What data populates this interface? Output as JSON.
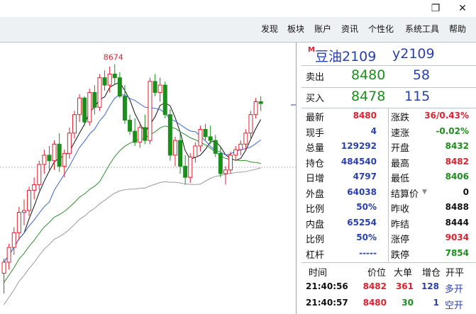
{
  "window": {
    "restore_glyph": "❐",
    "close_glyph": "✕"
  },
  "menu": [
    "发现",
    "板块",
    "账户",
    "资讯",
    "个性化",
    "系统工具",
    "帮助"
  ],
  "quote": {
    "badge": "M",
    "title": "豆油2109",
    "code": "y2109",
    "ask": {
      "label": "卖出",
      "price": "8480",
      "volume": "58"
    },
    "bid": {
      "label": "买入",
      "price": "8478",
      "volume": "115"
    }
  },
  "stats_left": [
    {
      "label": "最新",
      "value": "8480",
      "color": "red"
    },
    {
      "label": "现手",
      "value": "4",
      "color": "blue"
    },
    {
      "label": "总量",
      "value": "129292",
      "color": "blue"
    },
    {
      "label": "持仓",
      "value": "484540",
      "color": "blue"
    },
    {
      "label": "日增",
      "value": "4797",
      "color": "blue"
    },
    {
      "label": "外盘",
      "value": "64038",
      "color": "blue"
    },
    {
      "label": "比例",
      "value": "50%",
      "color": "blue"
    },
    {
      "label": "内盘",
      "value": "65254",
      "color": "blue"
    },
    {
      "label": "比例",
      "value": "50%",
      "color": "blue"
    },
    {
      "label": "杠杆",
      "value": "-----",
      "color": "blue"
    }
  ],
  "stats_right": [
    {
      "label": "涨跌",
      "value": "36/0.43%",
      "color": "red"
    },
    {
      "label": "速涨",
      "value": "-0.02%",
      "color": "green"
    },
    {
      "label": "开盘",
      "value": "8432",
      "color": "green"
    },
    {
      "label": "最高",
      "value": "8482",
      "color": "red"
    },
    {
      "label": "最低",
      "value": "8406",
      "color": "green"
    },
    {
      "label": "结算价",
      "value": "0",
      "color": "black"
    },
    {
      "label": "昨收",
      "value": "8488",
      "color": "black"
    },
    {
      "label": "昨结",
      "value": "8444",
      "color": "black"
    },
    {
      "label": "涨停",
      "value": "9034",
      "color": "red"
    },
    {
      "label": "跌停",
      "value": "7854",
      "color": "green"
    }
  ],
  "ticks": {
    "headers": [
      "时间",
      "价位",
      "大单",
      "增仓",
      "开平"
    ],
    "rows": [
      {
        "time": "21:40:56",
        "price": "8482",
        "size": "361",
        "oi": "128",
        "type": "多开"
      },
      {
        "time": "21:40:57",
        "price": "8480",
        "size": "30",
        "oi": "1",
        "type": "空开"
      }
    ]
  },
  "chart_data": {
    "type": "candlestick",
    "annotations": [
      "8674"
    ],
    "candles": [
      {
        "o": 7540,
        "h": 7620,
        "l": 7430,
        "c": 7600
      },
      {
        "o": 7600,
        "h": 7700,
        "l": 7560,
        "c": 7680
      },
      {
        "o": 7680,
        "h": 7790,
        "l": 7640,
        "c": 7760
      },
      {
        "o": 7760,
        "h": 7900,
        "l": 7720,
        "c": 7870
      },
      {
        "o": 7870,
        "h": 7940,
        "l": 7800,
        "c": 7880
      },
      {
        "o": 7880,
        "h": 8010,
        "l": 7850,
        "c": 7990
      },
      {
        "o": 7990,
        "h": 8060,
        "l": 7940,
        "c": 8020
      },
      {
        "o": 8020,
        "h": 8150,
        "l": 7990,
        "c": 8130
      },
      {
        "o": 8130,
        "h": 8210,
        "l": 8080,
        "c": 8180
      },
      {
        "o": 8180,
        "h": 8230,
        "l": 8100,
        "c": 8150
      },
      {
        "o": 8150,
        "h": 8260,
        "l": 8100,
        "c": 8240
      },
      {
        "o": 8240,
        "h": 8300,
        "l": 8090,
        "c": 8120
      },
      {
        "o": 8120,
        "h": 8210,
        "l": 8060,
        "c": 8190
      },
      {
        "o": 8190,
        "h": 8330,
        "l": 8160,
        "c": 8300
      },
      {
        "o": 8300,
        "h": 8420,
        "l": 8270,
        "c": 8400
      },
      {
        "o": 8400,
        "h": 8510,
        "l": 8360,
        "c": 8490
      },
      {
        "o": 8490,
        "h": 8500,
        "l": 8340,
        "c": 8360
      },
      {
        "o": 8360,
        "h": 8540,
        "l": 8340,
        "c": 8520
      },
      {
        "o": 8520,
        "h": 8560,
        "l": 8400,
        "c": 8440
      },
      {
        "o": 8440,
        "h": 8620,
        "l": 8420,
        "c": 8600
      },
      {
        "o": 8600,
        "h": 8640,
        "l": 8530,
        "c": 8560
      },
      {
        "o": 8560,
        "h": 8660,
        "l": 8520,
        "c": 8620
      },
      {
        "o": 8620,
        "h": 8674,
        "l": 8560,
        "c": 8600
      },
      {
        "o": 8600,
        "h": 8630,
        "l": 8490,
        "c": 8500
      },
      {
        "o": 8500,
        "h": 8560,
        "l": 8350,
        "c": 8370
      },
      {
        "o": 8370,
        "h": 8400,
        "l": 8290,
        "c": 8310
      },
      {
        "o": 8310,
        "h": 8380,
        "l": 8230,
        "c": 8250
      },
      {
        "o": 8250,
        "h": 8360,
        "l": 8220,
        "c": 8330
      },
      {
        "o": 8330,
        "h": 8400,
        "l": 8240,
        "c": 8260
      },
      {
        "o": 8260,
        "h": 8600,
        "l": 8240,
        "c": 8580
      },
      {
        "o": 8580,
        "h": 8620,
        "l": 8500,
        "c": 8520
      },
      {
        "o": 8520,
        "h": 8600,
        "l": 8470,
        "c": 8560
      },
      {
        "o": 8560,
        "h": 8580,
        "l": 8380,
        "c": 8400
      },
      {
        "o": 8400,
        "h": 8430,
        "l": 8150,
        "c": 8180
      },
      {
        "o": 8180,
        "h": 8280,
        "l": 8120,
        "c": 8260
      },
      {
        "o": 8260,
        "h": 8300,
        "l": 8080,
        "c": 8120
      },
      {
        "o": 8120,
        "h": 8180,
        "l": 8020,
        "c": 8060
      },
      {
        "o": 8060,
        "h": 8190,
        "l": 8030,
        "c": 8170
      },
      {
        "o": 8170,
        "h": 8250,
        "l": 8140,
        "c": 8230
      },
      {
        "o": 8230,
        "h": 8340,
        "l": 8200,
        "c": 8320
      },
      {
        "o": 8320,
        "h": 8350,
        "l": 8260,
        "c": 8280
      },
      {
        "o": 8280,
        "h": 8340,
        "l": 8240,
        "c": 8260
      },
      {
        "o": 8260,
        "h": 8290,
        "l": 8170,
        "c": 8190
      },
      {
        "o": 8190,
        "h": 8230,
        "l": 8060,
        "c": 8080
      },
      {
        "o": 8080,
        "h": 8120,
        "l": 8020,
        "c": 8100
      },
      {
        "o": 8100,
        "h": 8200,
        "l": 8080,
        "c": 8180
      },
      {
        "o": 8180,
        "h": 8230,
        "l": 8150,
        "c": 8210
      },
      {
        "o": 8210,
        "h": 8260,
        "l": 8180,
        "c": 8240
      },
      {
        "o": 8240,
        "h": 8320,
        "l": 8210,
        "c": 8300
      },
      {
        "o": 8300,
        "h": 8420,
        "l": 8260,
        "c": 8400
      },
      {
        "o": 8400,
        "h": 8490,
        "l": 8380,
        "c": 8470
      },
      {
        "o": 8470,
        "h": 8500,
        "l": 8420,
        "c": 8460
      }
    ]
  }
}
